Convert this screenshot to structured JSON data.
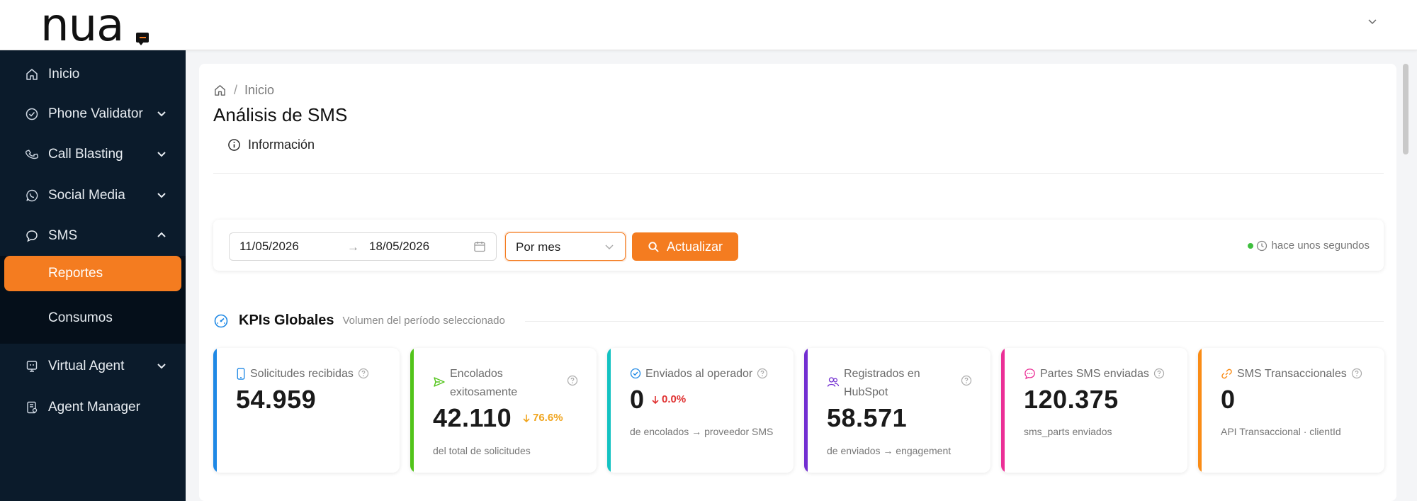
{
  "app": {
    "logo_text": "nua"
  },
  "sidebar": {
    "items": [
      {
        "label": "Inicio",
        "icon": "home-icon"
      },
      {
        "label": "Phone Validator",
        "icon": "check-circle-icon",
        "expandable": true
      },
      {
        "label": "Call Blasting",
        "icon": "phone-icon",
        "expandable": true
      },
      {
        "label": "Social Media",
        "icon": "whatsapp-icon",
        "expandable": true
      },
      {
        "label": "SMS",
        "icon": "message-icon",
        "expanded": true
      },
      {
        "label": "Virtual Agent",
        "icon": "monitor-icon",
        "expandable": true
      },
      {
        "label": "Agent Manager",
        "icon": "agent-icon"
      }
    ],
    "sms_submenu": [
      {
        "label": "Reportes",
        "active": true
      },
      {
        "label": "Consumos",
        "active": false
      }
    ]
  },
  "breadcrumb": {
    "home_icon": "home-icon",
    "separator": "/",
    "current": "Inicio"
  },
  "page": {
    "title": "Análisis de SMS",
    "info_tab": "Información"
  },
  "filters": {
    "date_from": "11/05/2026",
    "date_arrow": "→",
    "date_to": "18/05/2026",
    "period": "Por mes",
    "update_button": "Actualizar",
    "status_text": "hace unos segundos"
  },
  "kpis": {
    "title": "KPIs Globales",
    "subtitle": "Volumen del período seleccionado",
    "cards": [
      {
        "label": "Solicitudes recibidas",
        "value": "54.959",
        "trend": "",
        "note": "",
        "color": "#1e88e5",
        "icon": "mobile-icon"
      },
      {
        "label_line1": "Encolados",
        "label_line2": "exitosamente",
        "value": "42.110",
        "trend": "76.6%",
        "note": "del total de solicitudes",
        "color": "#52c41a",
        "icon": "send-icon"
      },
      {
        "label": "Enviados al operador",
        "value": "0",
        "trend": "0.0%",
        "note": "de encolados → proveedor SMS",
        "color": "#13c2c2",
        "icon": "check-circle-icon"
      },
      {
        "label_line1": "Registrados en",
        "label_line2": "HubSpot",
        "value": "58.571",
        "trend": "",
        "note": "de enviados → engagement",
        "color": "#722ed1",
        "icon": "users-icon"
      },
      {
        "label": "Partes SMS enviadas",
        "value": "120.375",
        "trend": "",
        "note": "sms_parts enviados",
        "color": "#eb2f96",
        "icon": "chat-dots-icon"
      },
      {
        "label": "SMS Transaccionales",
        "value": "0",
        "trend": "",
        "note": "API Transaccional · clientId",
        "color": "#fa8c16",
        "icon": "link-icon"
      }
    ]
  }
}
